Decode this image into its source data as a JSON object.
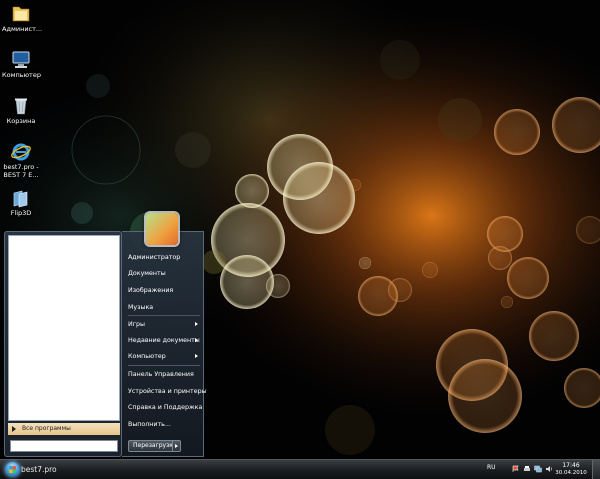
{
  "desktop": {
    "icons": [
      {
        "label": "Админист...",
        "icon": "folder-icon"
      },
      {
        "label": "Компьютер",
        "icon": "computer-icon"
      },
      {
        "label": "Корзина",
        "icon": "recycle-bin-icon"
      },
      {
        "label": "best7.pro -\nBEST 7 E...",
        "icon": "internet-explorer-icon"
      },
      {
        "label": "Flip3D",
        "icon": "flip3d-icon"
      }
    ]
  },
  "start_menu": {
    "all_programs": "Все программы",
    "search_placeholder": "",
    "right_items": [
      {
        "label": "Администратор",
        "has_submenu": false
      },
      {
        "label": "Документы",
        "has_submenu": false
      },
      {
        "label": "Изображения",
        "has_submenu": false
      },
      {
        "label": "Музыка",
        "has_submenu": false
      },
      {
        "label": "Игры",
        "has_submenu": true
      },
      {
        "label": "Недавние документы",
        "has_submenu": true
      },
      {
        "label": "Компьютер",
        "has_submenu": true
      },
      {
        "label": "Панель Управления",
        "has_submenu": false
      },
      {
        "label": "Устройства и принтеры",
        "has_submenu": false
      },
      {
        "label": "Справка и Поддержка",
        "has_submenu": false
      },
      {
        "label": "Выполнить...",
        "has_submenu": false
      }
    ],
    "shutdown_label": "Перезагрузка"
  },
  "taskbar": {
    "brand": "best7.pro",
    "language": "RU",
    "time": "17:46",
    "date": "30.04.2010"
  },
  "colors": {
    "accent_blue": "#4aa0d8",
    "bokeh_orange": "#e8822a",
    "bokeh_yellow": "#f5e6a0"
  }
}
